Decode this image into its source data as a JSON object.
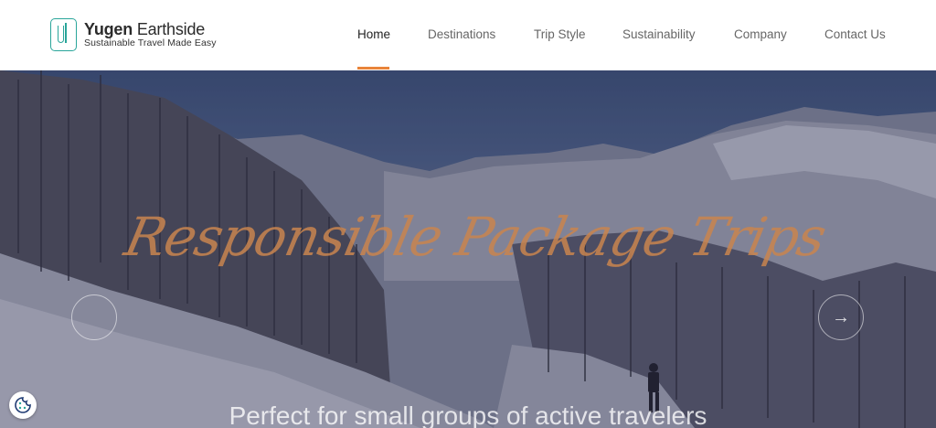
{
  "brand": {
    "name_bold": "Yugen",
    "name_rest": " Earthside",
    "tagline": "Sustainable Travel Made Easy"
  },
  "nav": {
    "items": [
      {
        "label": "Home",
        "active": true
      },
      {
        "label": "Destinations"
      },
      {
        "label": "Trip Style"
      },
      {
        "label": "Sustainability"
      },
      {
        "label": "Company"
      },
      {
        "label": "Contact Us"
      }
    ]
  },
  "hero": {
    "title": "Responsible Package Trips",
    "subtitle": "Perfect for small groups of active travelers",
    "prev_icon": "arrow-left-icon",
    "next_icon": "arrow-right-icon",
    "next_glyph": "→"
  },
  "colors": {
    "accent": "#e8843a",
    "brand": "#2aa59a",
    "title_script": "#c9854f"
  },
  "cookie_icon": "cookie-icon"
}
